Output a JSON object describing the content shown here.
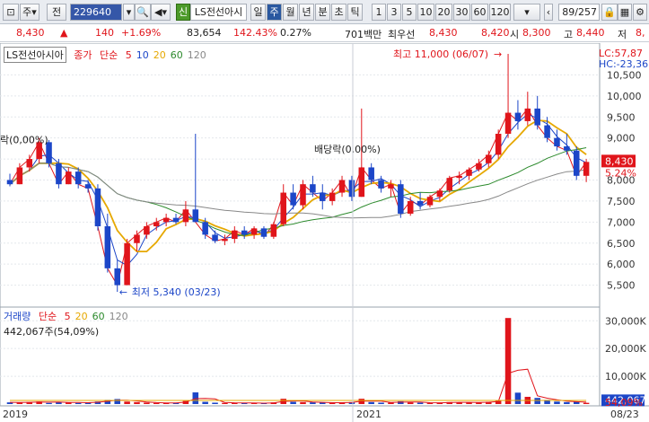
{
  "toolbar": {
    "market": "주",
    "all_label": "전",
    "code": "229640",
    "new_badge": "신",
    "name": "LS전선아시",
    "periods": [
      "일",
      "주",
      "월",
      "년",
      "분",
      "초",
      "틱"
    ],
    "selected_period": "주",
    "numbers": [
      "1",
      "3",
      "5",
      "10",
      "20",
      "30",
      "60",
      "120"
    ],
    "counter": "89/257"
  },
  "info": {
    "price": "8,430",
    "change": "140",
    "change_pct": "+1.69%",
    "volume": "83,654",
    "vol_ratio": "142.43%",
    "turnover": "0.27%",
    "amount": "701백만",
    "best_label": "최우선",
    "bid1": "8,430",
    "bid2": "8,420",
    "open_label": "시",
    "open": "8,300",
    "high_label": "고",
    "high": "8,440",
    "low_label": "저",
    "low": "8,"
  },
  "legend": {
    "stock_name": "LS전선아시아",
    "close_label": "종가",
    "ma_label": "단순",
    "ma_periods": [
      "5",
      "10",
      "20",
      "60",
      "120"
    ],
    "ma_colors": [
      "#e0151b",
      "#1c46c8",
      "#e6a800",
      "#2c8a2c",
      "#888888"
    ]
  },
  "vol_legend": {
    "label": "거래량",
    "ma_label": "단순",
    "ma_periods": [
      "5",
      "20",
      "60",
      "120"
    ],
    "ma_colors": [
      "#e0151b",
      "#e6a800",
      "#2c8a2c",
      "#888888"
    ],
    "current": "442,067주(54,09%)"
  },
  "annotations": {
    "high": "최고 11,000 (06/07)",
    "low": "최저 5,340 (03/23)",
    "div1": "배당락(0,00%)",
    "div2": "락(0,00%)",
    "lc": "LC:57,87",
    "hc": "HC:-23,36",
    "cur_price": "8,430",
    "cur_pct": "5.24%",
    "cur_vol": "442,067",
    "cur_vol_pct": "54,09%"
  },
  "chart_data": {
    "type": "candlestick",
    "price_axis": {
      "ticks": [
        "10,500",
        "10,000",
        "9,500",
        "9,000",
        "8,500",
        "8,000",
        "7,500",
        "7,000",
        "6,500",
        "6,000",
        "5,500"
      ],
      "range": [
        5000,
        11000
      ]
    },
    "volume_axis": {
      "ticks": [
        "30,000K",
        "20,000K",
        "10,000K"
      ],
      "range": [
        0,
        33000
      ]
    },
    "x_labels": [
      "2019",
      "2021",
      "08/23"
    ],
    "candles": [
      [
        8000,
        8150,
        7850,
        7900
      ],
      [
        7900,
        8400,
        7900,
        8300
      ],
      [
        8300,
        8600,
        8200,
        8500
      ],
      [
        8500,
        9000,
        8400,
        8900
      ],
      [
        8900,
        8950,
        8300,
        8400
      ],
      [
        8400,
        8500,
        7800,
        7900
      ],
      [
        7900,
        8300,
        7900,
        8200
      ],
      [
        8200,
        8300,
        7800,
        7900
      ],
      [
        7900,
        8000,
        7700,
        7800
      ],
      [
        7800,
        7900,
        6800,
        6900
      ],
      [
        6900,
        7200,
        5800,
        5900
      ],
      [
        5900,
        6100,
        5340,
        5500
      ],
      [
        5500,
        6600,
        5500,
        6500
      ],
      [
        6500,
        6800,
        6300,
        6700
      ],
      [
        6700,
        7000,
        6600,
        6900
      ],
      [
        6900,
        7100,
        6800,
        7000
      ],
      [
        7000,
        7200,
        6900,
        7100
      ],
      [
        7100,
        7200,
        6950,
        7000
      ],
      [
        7000,
        7500,
        6900,
        7300
      ],
      [
        7300,
        9100,
        7000,
        7000
      ],
      [
        7000,
        7100,
        6600,
        6700
      ],
      [
        6700,
        6800,
        6500,
        6550
      ],
      [
        6550,
        6700,
        6450,
        6600
      ],
      [
        6600,
        6900,
        6500,
        6800
      ],
      [
        6800,
        6900,
        6600,
        6700
      ],
      [
        6700,
        6900,
        6600,
        6850
      ],
      [
        6850,
        6900,
        6600,
        6650
      ],
      [
        6650,
        7000,
        6600,
        6950
      ],
      [
        6950,
        7900,
        6900,
        7700
      ],
      [
        7700,
        7900,
        7300,
        7400
      ],
      [
        7400,
        8000,
        7300,
        7900
      ],
      [
        7900,
        8100,
        7600,
        7700
      ],
      [
        7700,
        7900,
        7300,
        7500
      ],
      [
        7500,
        7800,
        7400,
        7700
      ],
      [
        7700,
        8100,
        7600,
        8000
      ],
      [
        8000,
        8100,
        7500,
        7600
      ],
      [
        7600,
        9700,
        7600,
        8300
      ],
      [
        8300,
        8400,
        7900,
        8000
      ],
      [
        8000,
        8100,
        7700,
        7800
      ],
      [
        7800,
        8000,
        7600,
        7900
      ],
      [
        7900,
        8000,
        7100,
        7200
      ],
      [
        7200,
        7600,
        7150,
        7500
      ],
      [
        7500,
        7700,
        7300,
        7400
      ],
      [
        7400,
        7650,
        7350,
        7600
      ],
      [
        7600,
        7800,
        7500,
        7750
      ],
      [
        7750,
        8100,
        7700,
        8050
      ],
      [
        8050,
        8200,
        7900,
        8100
      ],
      [
        8100,
        8300,
        8000,
        8250
      ],
      [
        8250,
        8500,
        8200,
        8400
      ],
      [
        8400,
        8700,
        8300,
        8600
      ],
      [
        8600,
        9200,
        8500,
        9100
      ],
      [
        9100,
        11000,
        9000,
        9600
      ],
      [
        9600,
        9900,
        9200,
        9400
      ],
      [
        9400,
        10100,
        9300,
        9700
      ],
      [
        9700,
        10000,
        9200,
        9300
      ],
      [
        9300,
        9500,
        8900,
        9000
      ],
      [
        9000,
        9200,
        8700,
        8800
      ],
      [
        8800,
        9100,
        8600,
        8700
      ],
      [
        8700,
        8800,
        8000,
        8100
      ],
      [
        8100,
        8500,
        7950,
        8430
      ]
    ],
    "volumes": [
      600,
      500,
      700,
      900,
      400,
      800,
      500,
      400,
      600,
      900,
      1500,
      1800,
      900,
      700,
      500,
      400,
      400,
      500,
      1100,
      4200,
      800,
      500,
      400,
      500,
      400,
      300,
      300,
      600,
      1900,
      800,
      700,
      600,
      500,
      400,
      600,
      700,
      1900,
      700,
      500,
      500,
      1000,
      600,
      500,
      400,
      500,
      700,
      600,
      500,
      600,
      800,
      1400,
      31000,
      4100,
      2600,
      2200,
      1500,
      900,
      700,
      900,
      442
    ]
  }
}
